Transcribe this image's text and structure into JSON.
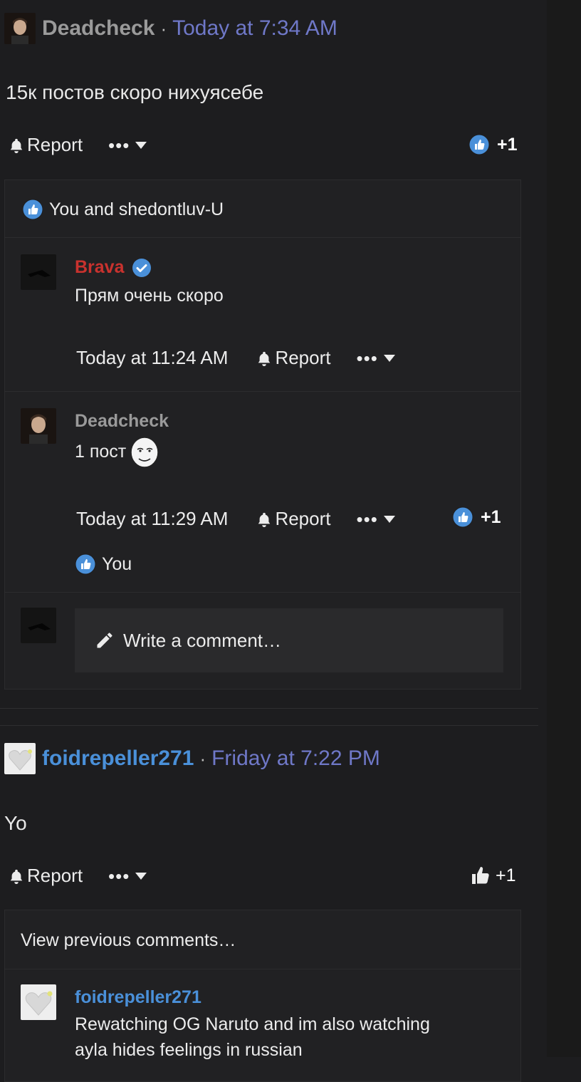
{
  "post1": {
    "author": "Deadcheck",
    "separator": "·",
    "time": "Today at 7:34 AM",
    "text": "15к постов скоро нихуясебе",
    "report_label": "Report",
    "more_label": "•••",
    "like_count": "+1",
    "likers": "You and shedontluv-U",
    "comments": [
      {
        "author": "Brava",
        "text": "Прям очень скоро",
        "time": "Today at 11:24 AM",
        "report_label": "Report",
        "more_label": "•••"
      },
      {
        "author": "Deadcheck",
        "text": "1 пост",
        "time": "Today at 11:29 AM",
        "report_label": "Report",
        "more_label": "•••",
        "like_count": "+1",
        "likers": "You"
      }
    ],
    "write_placeholder": "Write a comment…"
  },
  "post2": {
    "author": "foidrepeller271",
    "separator": "·",
    "time": "Friday at 7:22 PM",
    "text": "Yo",
    "report_label": "Report",
    "more_label": "•••",
    "like_count": "+1",
    "view_previous": "View previous comments…",
    "comment": {
      "author": "foidrepeller271",
      "text_line1": "Rewatching OG Naruto and im also watching",
      "text_line2": "ayla hides feelings in russian"
    }
  },
  "colors": {
    "accent_blue": "#4a90d9",
    "timestamp": "#6f78c8",
    "verified": "#4a90d9",
    "admin_red": "#c9322e"
  },
  "icons": [
    "bell-icon",
    "caret-down-icon",
    "like-icon",
    "verified-icon",
    "pencil-icon",
    "thumbs-up-outline-icon"
  ]
}
